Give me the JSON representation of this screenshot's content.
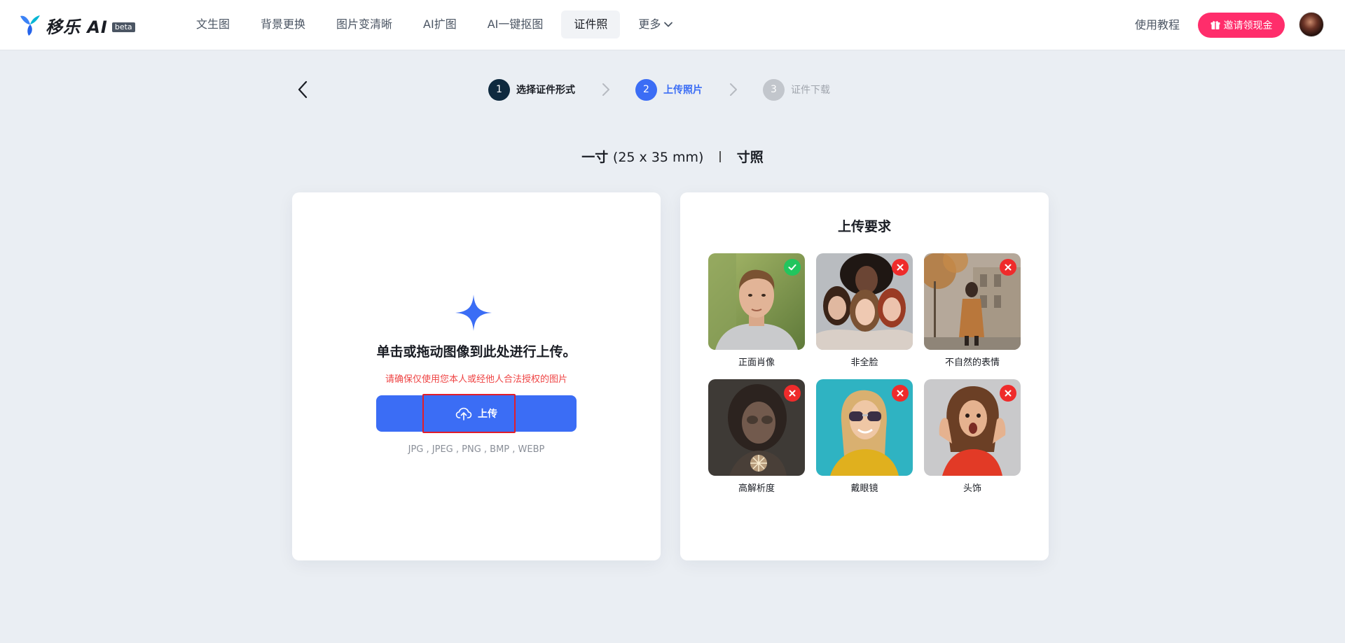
{
  "header": {
    "logo_text": "移乐 AI",
    "logo_badge": "beta",
    "nav": [
      "文生图",
      "背景更换",
      "图片变清晰",
      "AI扩图",
      "AI一键抠图",
      "证件照",
      "更多"
    ],
    "tutorial": "使用教程",
    "invite": "邀请领现金"
  },
  "steps": [
    {
      "num": "1",
      "label": "选择证件形式",
      "state": "done"
    },
    {
      "num": "2",
      "label": "上传照片",
      "state": "current"
    },
    {
      "num": "3",
      "label": "证件下载",
      "state": "pending"
    }
  ],
  "spec": {
    "name": "一寸",
    "dimensions": "(25 x 35 mm)",
    "type": "寸照"
  },
  "upload": {
    "title": "单击或拖动图像到此处进行上传。",
    "warning": "请确保仅使用您本人或经他人合法授权的图片",
    "button": "上传",
    "formats": "JPG , JPEG , PNG , BMP , WEBP"
  },
  "requirements": {
    "title": "上传要求",
    "items": [
      {
        "label": "正面肖像",
        "ok": true
      },
      {
        "label": "非全脸",
        "ok": false
      },
      {
        "label": "不自然的表情",
        "ok": false
      },
      {
        "label": "高解析度",
        "ok": false
      },
      {
        "label": "戴眼镜",
        "ok": false
      },
      {
        "label": "头饰",
        "ok": false
      }
    ]
  },
  "colors": {
    "accent": "#3b6df5",
    "invite": "#ff2d6b",
    "ok": "#22c55e",
    "no": "#ef2b2b",
    "warning": "#ef4444",
    "step_done": "#0f2a3f",
    "step_pending": "#c2c6cc"
  }
}
